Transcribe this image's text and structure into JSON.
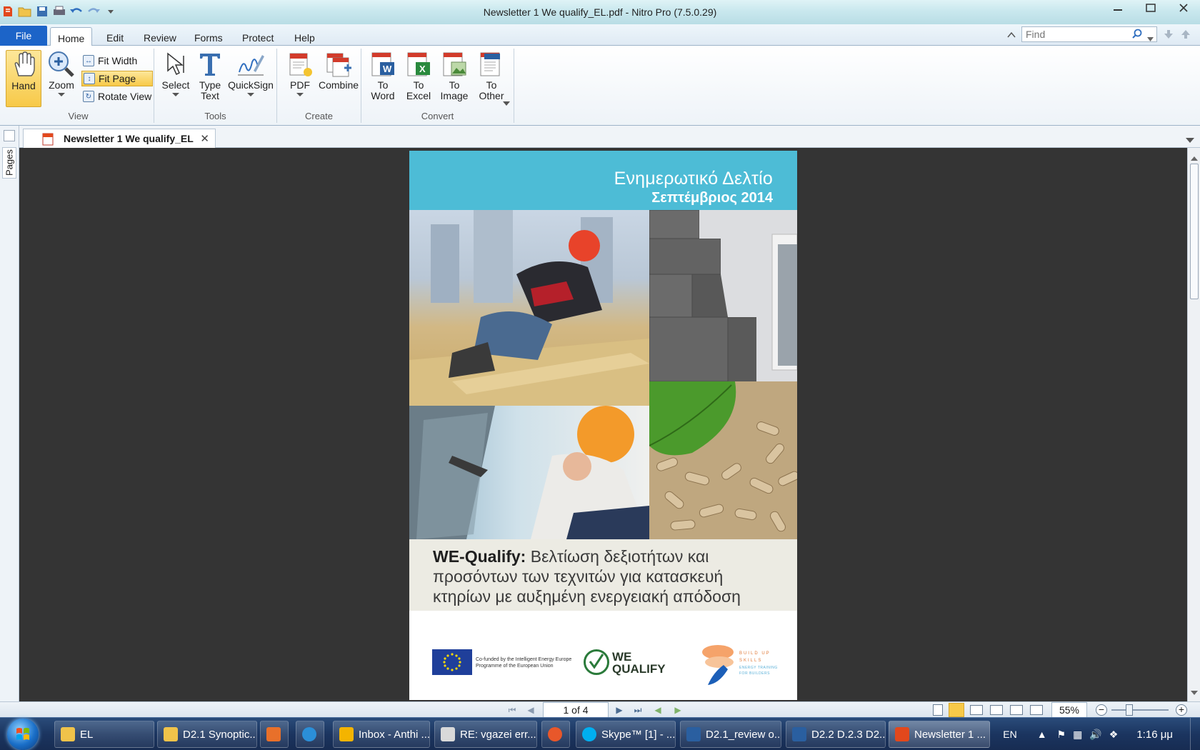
{
  "window": {
    "title": "Newsletter 1 We qualify_EL.pdf - Nitro Pro (7.5.0.29)"
  },
  "ribbon_tabs": {
    "file": "File",
    "home": "Home",
    "edit": "Edit",
    "review": "Review",
    "forms": "Forms",
    "protect": "Protect",
    "help": "Help"
  },
  "find": {
    "placeholder": "Find"
  },
  "ribbon": {
    "view": {
      "label": "View",
      "hand": "Hand",
      "zoom": "Zoom",
      "fit_width": "Fit Width",
      "fit_page": "Fit Page",
      "rotate_view": "Rotate View"
    },
    "tools": {
      "label": "Tools",
      "select": "Select",
      "type_text_1": "Type",
      "type_text_2": "Text",
      "quicksign": "QuickSign"
    },
    "create": {
      "label": "Create",
      "pdf": "PDF",
      "combine": "Combine"
    },
    "convert": {
      "label": "Convert",
      "to": "To",
      "word": "Word",
      "excel": "Excel",
      "image": "Image",
      "other": "Other"
    }
  },
  "document_tab": {
    "name": "Newsletter 1 We qualify_EL"
  },
  "side_panel": {
    "pages_label": "Pages"
  },
  "page": {
    "header_line1": "Ενημερωτικό Δελτίο",
    "header_line2": "Σεπτέμβριος 2014",
    "title_bold": "WE-Qualify:",
    "title_rest_1": " Βελτίωση δεξιοτήτων και",
    "title_rest_2": "προσόντων των τεχνιτών για κατασκευή",
    "title_rest_3": "κτηρίων με αυξημένη ενεργειακή απόδοση",
    "eu_text_1": "Co-funded by the Intelligent Energy Europe",
    "eu_text_2": "Programme of the European Union",
    "we": "WE",
    "qualify": "QUALIFY",
    "buildup_1": "BUILD UP",
    "buildup_2": "SKILLS",
    "buildup_3": "ENERGY TRAINING",
    "buildup_4": "FOR BUILDERS"
  },
  "status": {
    "page_indicator": "1 of 4",
    "zoom": "55%"
  },
  "taskbar": {
    "items": [
      {
        "label": "EL"
      },
      {
        "label": "D2.1 Synoptic..."
      },
      {
        "label": ""
      },
      {
        "label": ""
      },
      {
        "label": "Inbox - Anthi ..."
      },
      {
        "label": "RE: vgazei err..."
      },
      {
        "label": ""
      },
      {
        "label": "Skype™ [1] - ..."
      },
      {
        "label": "D2.1_review o..."
      },
      {
        "label": "D2.2 D.2.3 D2..."
      },
      {
        "label": "Newsletter 1 ..."
      }
    ],
    "language": "EN",
    "clock": "1:16 μμ"
  },
  "colors": {
    "accent_blue": "#1c64c8",
    "header_cyan": "#4dbcd6",
    "selected_yellow": "#f7c948",
    "viewer_bg": "#343434"
  }
}
